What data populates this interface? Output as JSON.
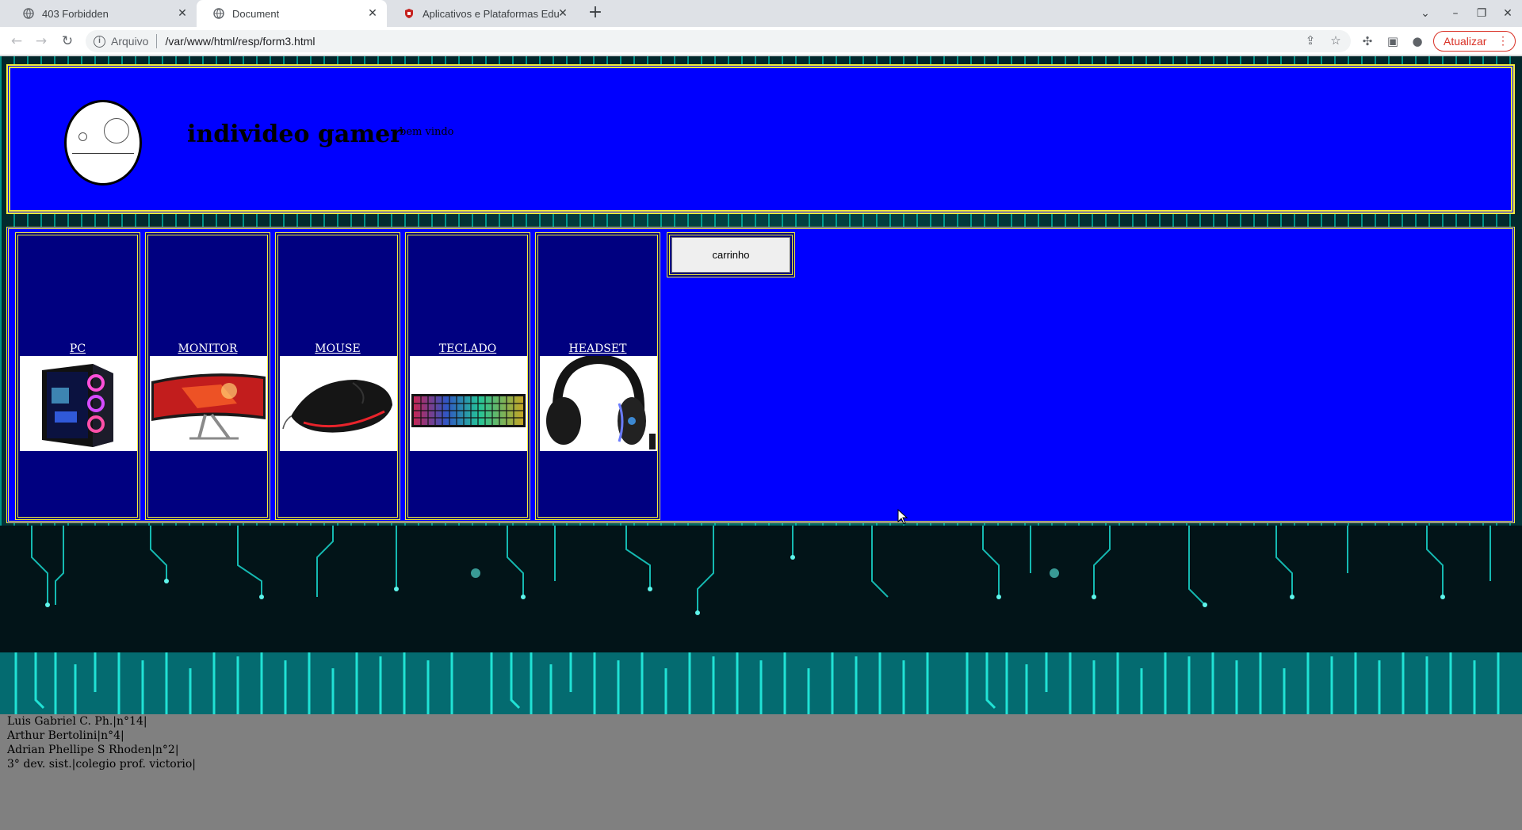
{
  "browser": {
    "tabs": [
      {
        "title": "403 Forbidden",
        "active": false
      },
      {
        "title": "Document",
        "active": true
      },
      {
        "title": "Aplicativos e Plataformas Edu",
        "active": false
      }
    ],
    "new_tab_symbol": "+",
    "window_controls": {
      "tab_search": "⌄",
      "minimize": "–",
      "restore": "❐",
      "close": "✕"
    },
    "omnibox": {
      "scheme_label": "Arquivo",
      "url": "/var/www/html/resp/form3.html"
    },
    "update_button": "Atualizar",
    "icons": {
      "back": "back-arrow-icon",
      "forward": "forward-arrow-icon",
      "reload": "reload-icon",
      "share": "share-icon",
      "bookmark": "star-icon",
      "extensions": "puzzle-icon",
      "side_panel": "side-panel-icon",
      "profile": "profile-icon",
      "menu": "more-vertical-icon"
    }
  },
  "page": {
    "header": {
      "title": "individeo gamer",
      "welcome": "bem vindo"
    },
    "products": [
      {
        "label": "PC",
        "image": "pc-tower-image"
      },
      {
        "label": "MONITOR",
        "image": "monitor-image"
      },
      {
        "label": "MOUSE",
        "image": "mouse-image"
      },
      {
        "label": "TECLADO",
        "image": "keyboard-image"
      },
      {
        "label": "HEADSET",
        "image": "headset-image"
      }
    ],
    "cart_button": "carrinho",
    "footer": [
      "Luis Gabriel C. Ph.|n°14|",
      "Arthur Bertolini|n°4|",
      "Adrian Phellipe S Rhoden|n°2|",
      "3° dev. sist.|colegio prof. victorio|"
    ]
  },
  "colors": {
    "panel_blue": "#0000ff",
    "card_navy": "#000080",
    "border_yellow": "#f4ee3a",
    "footer_gray": "#808080",
    "update_red": "#d93025"
  }
}
